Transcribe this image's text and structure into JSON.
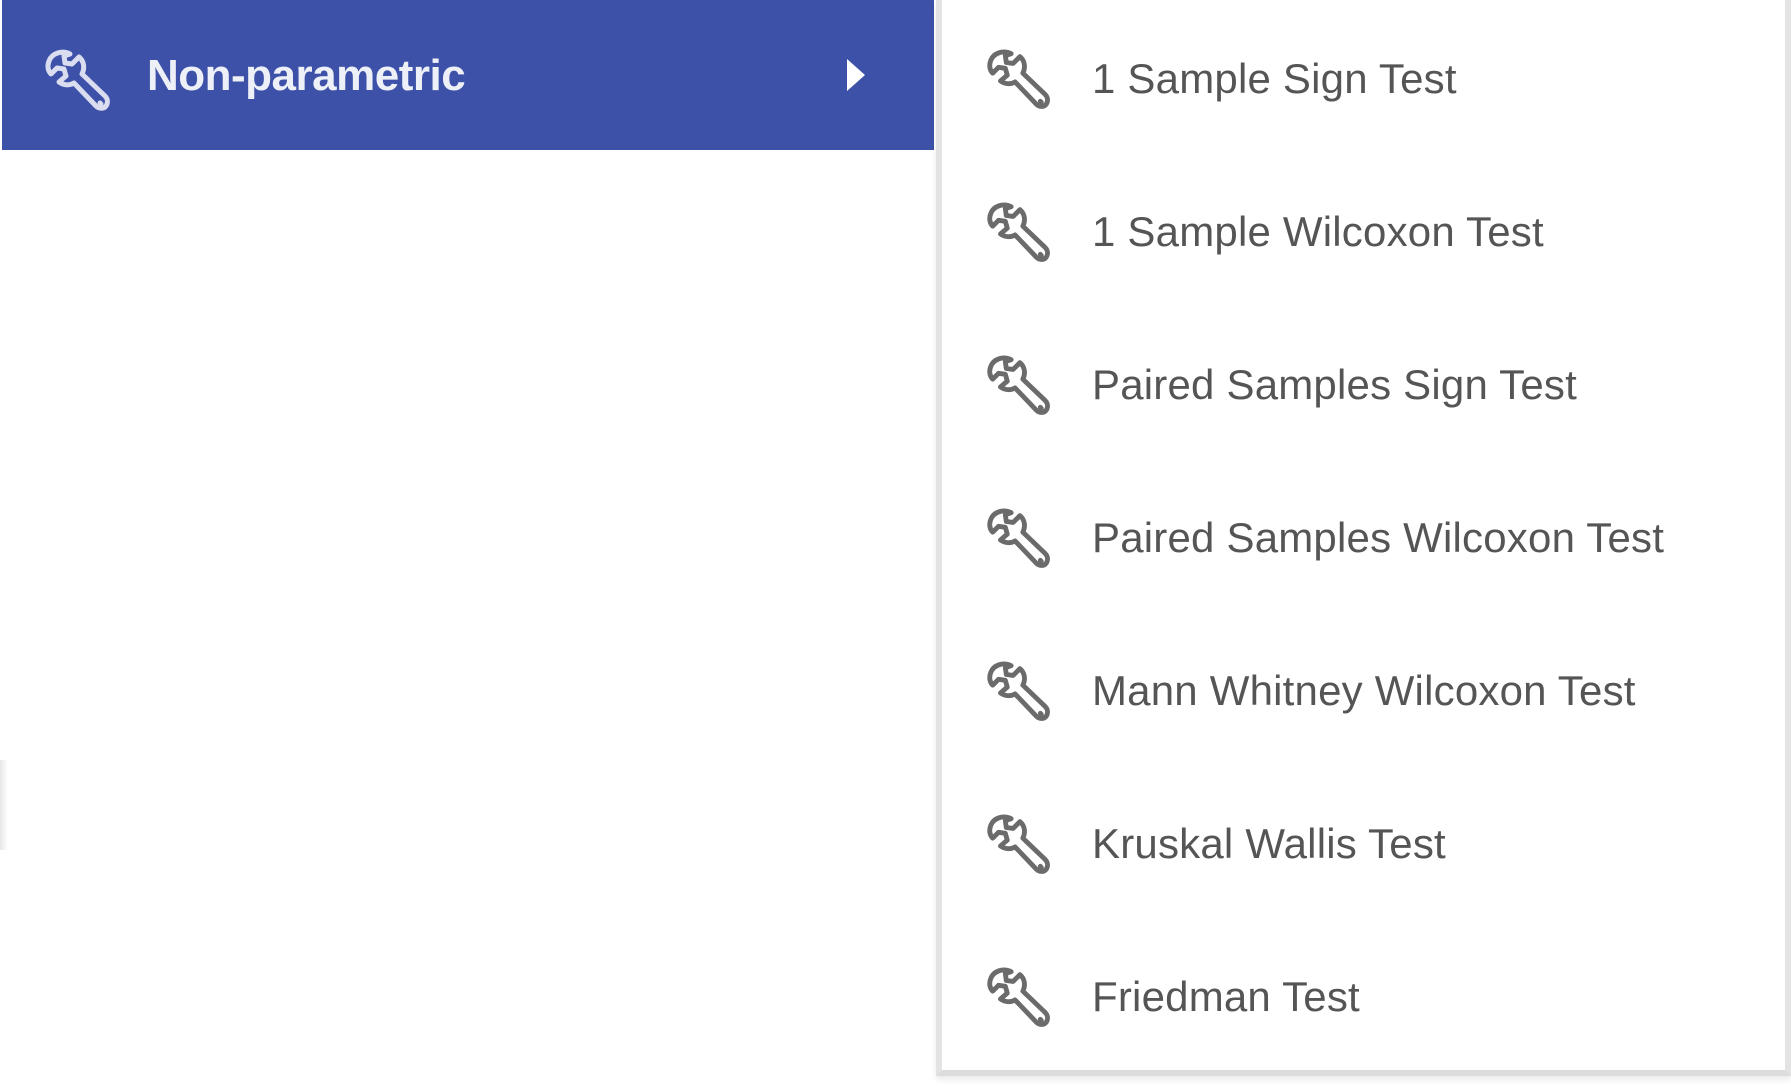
{
  "main_menu": {
    "selected_item": {
      "label": "Non-parametric",
      "icon": "wrench-icon",
      "background_color": "#3d51a8"
    }
  },
  "submenu": {
    "items": [
      {
        "label": "1 Sample Sign Test",
        "icon": "wrench-icon"
      },
      {
        "label": "1 Sample Wilcoxon Test",
        "icon": "wrench-icon"
      },
      {
        "label": "Paired Samples Sign Test",
        "icon": "wrench-icon"
      },
      {
        "label": "Paired Samples Wilcoxon Test",
        "icon": "wrench-icon"
      },
      {
        "label": "Mann Whitney Wilcoxon Test",
        "icon": "wrench-icon"
      },
      {
        "label": "Kruskal Wallis Test",
        "icon": "wrench-icon"
      },
      {
        "label": "Friedman Test",
        "icon": "wrench-icon"
      }
    ]
  }
}
